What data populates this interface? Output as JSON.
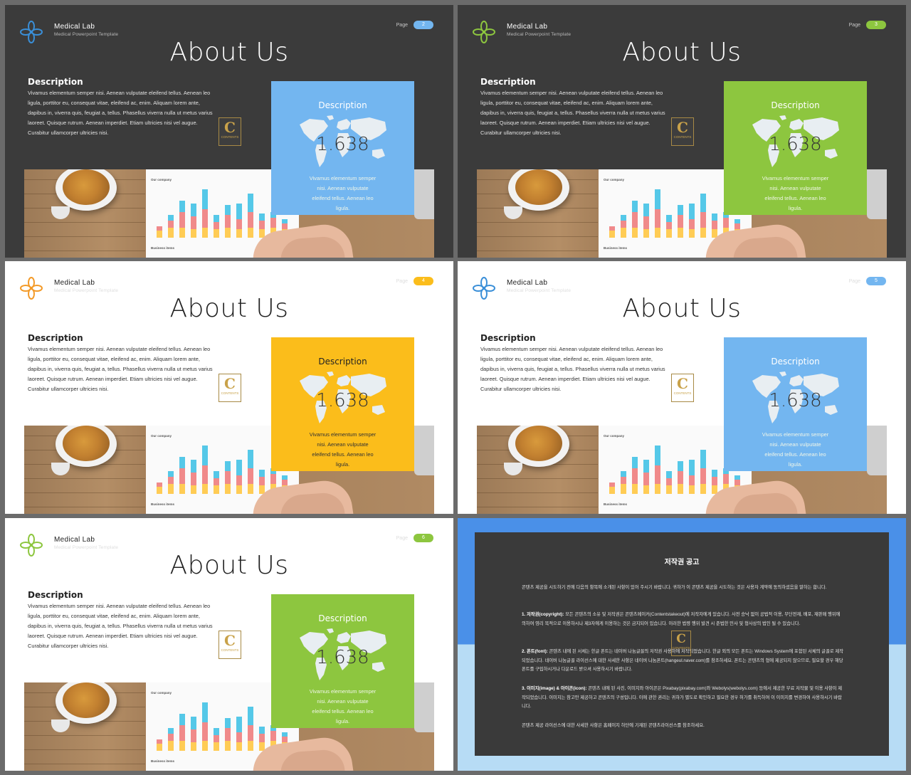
{
  "colors": {
    "dark_bg": "#3b3b3b",
    "blue": "#73b6f0",
    "green": "#8dc63f",
    "orange": "#fbbd1b",
    "notice_blue": "#4a90e8",
    "notice_light": "#b7dcf5"
  },
  "brand": {
    "name": "Medical Lab",
    "subtitle": "Medical Powerpoint Template"
  },
  "page_label": "Page",
  "slide_title": "About Us",
  "description_heading": "Description",
  "description_lines": [
    "Vivamus elementum semper nisi. Aenean vulputate eleifend tellus. Aenean leo",
    "ligula, porttitor eu, consequat vitae, eleifend ac, enim. Aliquam lorem ante,",
    "dapibus in, viverra quis, feugiat a, tellus. Phasellus viverra nulla ut metus varius",
    "laoreet. Quisque rutrum. Aenean imperdiet. Etiam ultricies nisi vel augue.",
    "Curabitur ullamcorper ultricies nisi."
  ],
  "card": {
    "title": "Description",
    "number": "1.638",
    "text_lines": [
      "Vivamus elementum semper",
      "nisi. Aenean vulputate",
      "eleifend tellus. Aenean leo",
      "ligula."
    ]
  },
  "stamp": {
    "letter": "C",
    "text": "CONTENTS"
  },
  "photo": {
    "paper_title": "Our company",
    "paper_footer": "Business items"
  },
  "slides": [
    {
      "page": "2",
      "theme": "dark",
      "accent": "#73b6f0",
      "logo": "blue"
    },
    {
      "page": "3",
      "theme": "dark",
      "accent": "#8dc63f",
      "logo": "green"
    },
    {
      "page": "4",
      "theme": "light",
      "accent": "#fbbd1b",
      "logo": "orange"
    },
    {
      "page": "5",
      "theme": "light",
      "accent": "#73b6f0",
      "logo": "blue"
    },
    {
      "page": "6",
      "theme": "light",
      "accent": "#8dc63f",
      "logo": "green"
    }
  ],
  "notice": {
    "title": "저작권 공고",
    "intro": "콘텐츠 제공을 시도하기 전에 다음의 항목에 소개된 사항이 있어 주시기 바랍니다. 귀하가 이 콘텐츠 제공을 시도하는 것은 사용자 계약에 동의하셨음을 말하는 합니다.",
    "p1_label": "1. 저작권(copyright):",
    "p1": "모든 콘텐츠의 소유 및 저작권은 콘텐츠메이커(Contentstakeout)에 저작자에게 있습니다. 사전 승낙 없이 공법적 이용, 무단전재, 배포, 재판매 행위에 의하여 영리 목적으로 이용하시나 제3자에게 이용하는 것은 금지되어 있습니다. 이러한 법령 행위 발견 시 준법한 민사 및 형사상의 법인 될 수 있습니다.",
    "p2_label": "2. 폰트(font):",
    "p2": "콘텐츠 내에 된 서체는 한글 폰트는 네이버 나눔글꼴의 저작권 사용하에 저작되었습니다. 한글 외의 모든 폰트는 Windows System에 포함된 서체의 글꼴로 제작되었습니다. 네이버 나눔글꼴 라이선스에 대한 사세한 사항은 네이버 나눔폰트(hangeul.naver.com)를 참조하세요. 폰트는 콘텐츠의 형에 제공되지 않으므로, 필요할 경우 해당 폰트를 구입하시거나 다운로드 받으셔 사용하시기 바랍니다.",
    "p3_label": "3. 이미지(image) & 아이콘(icon):",
    "p3": "콘텐츠 내에 된 사진, 이미지와 아이콘은 Pixabay(pixabay.com)와 Webolys(webolys.com) 등에서 제공한 무료 저작물 및 이용 사항이 제작되었습니다. 이미지는 참고만 제공하고 콘텐츠의 구성입니다. 이에 관한 권리는 귀하가 별도로 확인하고 필요한 경우 허가를 취득하여 이 이미지를 변경하여 사용하시기 바랍니다.",
    "outro": "콘텐츠 제공 라이선스에 대한 사세한 사항은 홈페이지 하단에 기재된 콘텐츠라이선스를 참조하세요."
  }
}
